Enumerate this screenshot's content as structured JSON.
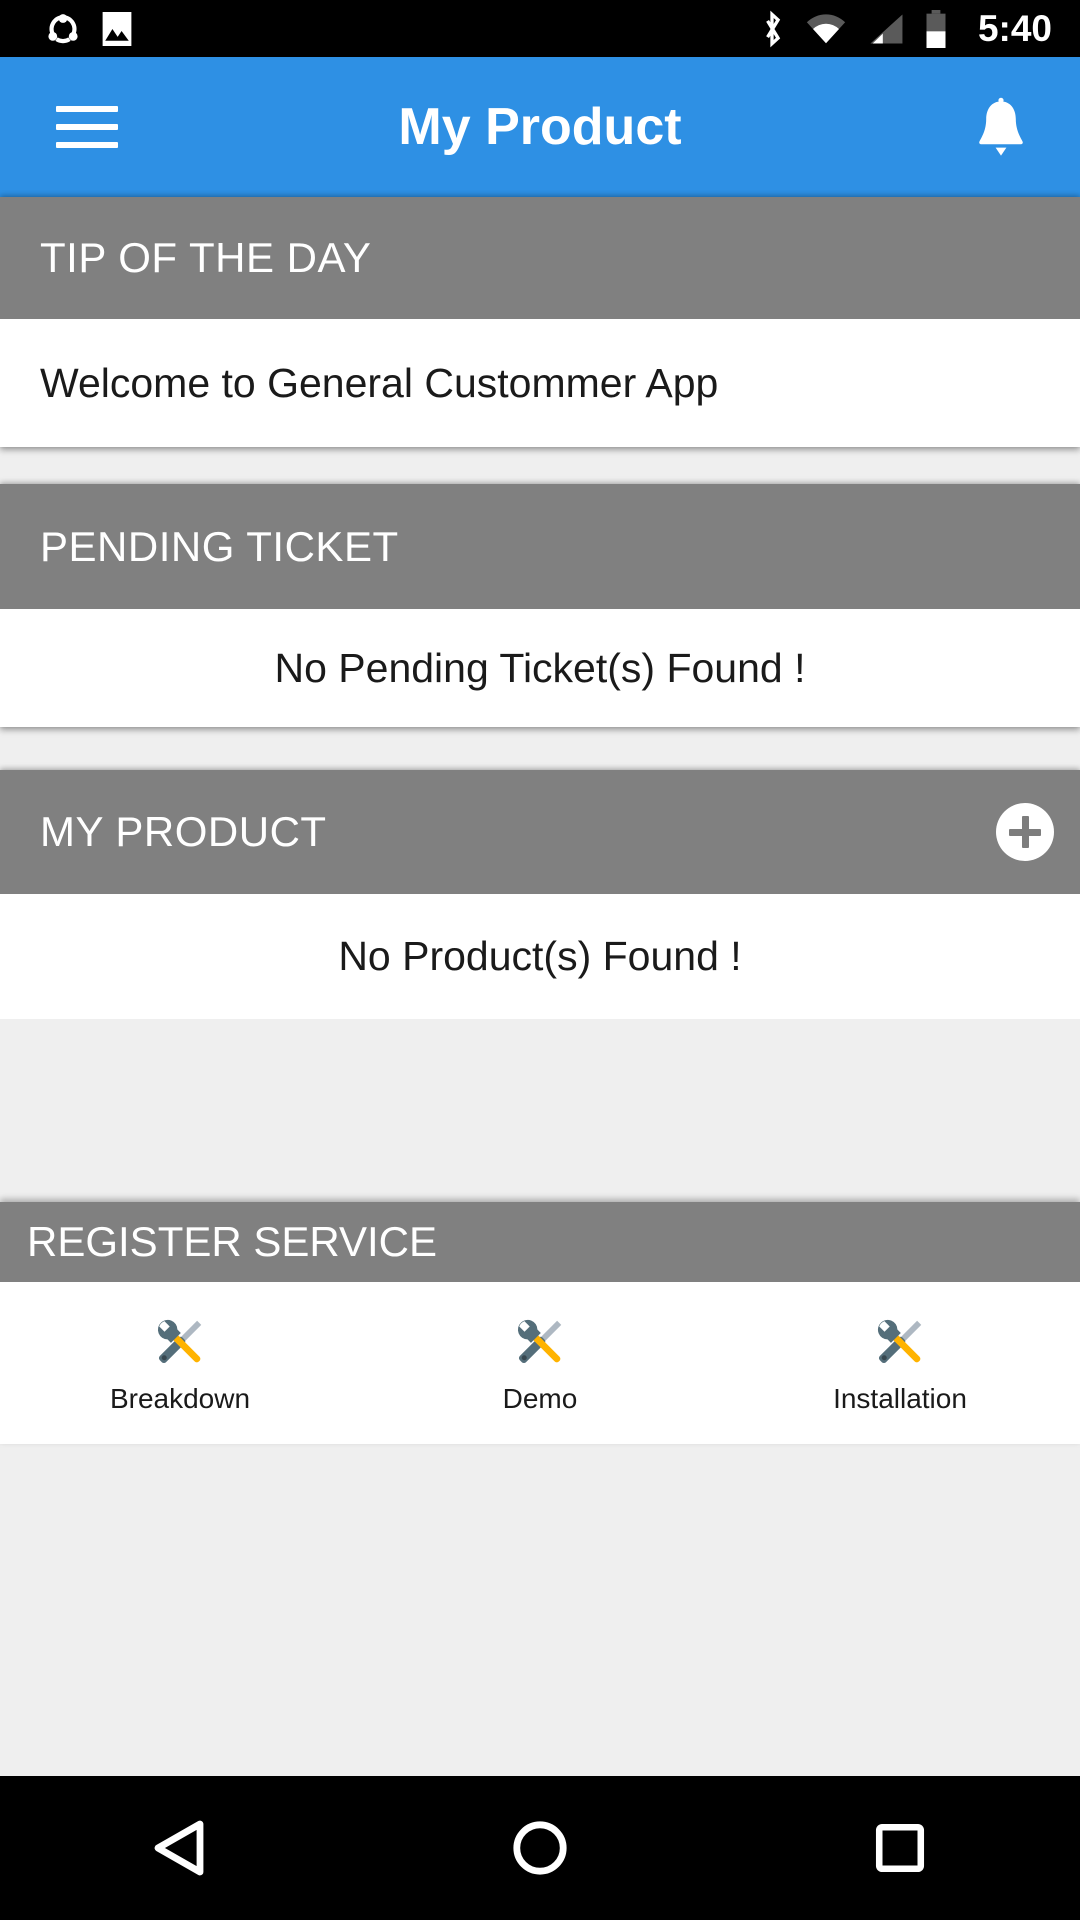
{
  "statusbar": {
    "icons": [
      "share-icon",
      "image-icon",
      "bluetooth-icon",
      "wifi-icon",
      "cell-signal-icon",
      "battery-icon"
    ],
    "clock": "5:40",
    "background": "#000000",
    "foreground": "#ffffff"
  },
  "appbar": {
    "title": "My Product",
    "menu_icon": "hamburger-menu-icon",
    "notification_icon": "bell-icon",
    "background": "#2e90e4",
    "text_color": "#ffffff"
  },
  "theme": {
    "section_header_bg": "#808080",
    "page_bg": "#efefef",
    "card_bg": "#ffffff",
    "body_text": "#1a1a1a"
  },
  "cards": {
    "tip": {
      "header": "TIP OF THE DAY",
      "body": "Welcome to General Custommer App"
    },
    "pending_ticket": {
      "header": "PENDING TICKET",
      "body": "No Pending Ticket(s) Found !"
    },
    "my_product": {
      "header": "MY PRODUCT",
      "body": "No Product(s) Found !",
      "add_button_icon": "plus-icon"
    },
    "register_service": {
      "header": "REGISTER SERVICE",
      "items": [
        {
          "label": "Breakdown",
          "icon": "tools-icon"
        },
        {
          "label": "Demo",
          "icon": "tools-icon"
        },
        {
          "label": "Installation",
          "icon": "tools-icon"
        }
      ]
    }
  },
  "navbar": {
    "back_icon": "back-triangle-icon",
    "home_icon": "home-circle-icon",
    "recents_icon": "recents-square-icon",
    "background": "#000000"
  }
}
